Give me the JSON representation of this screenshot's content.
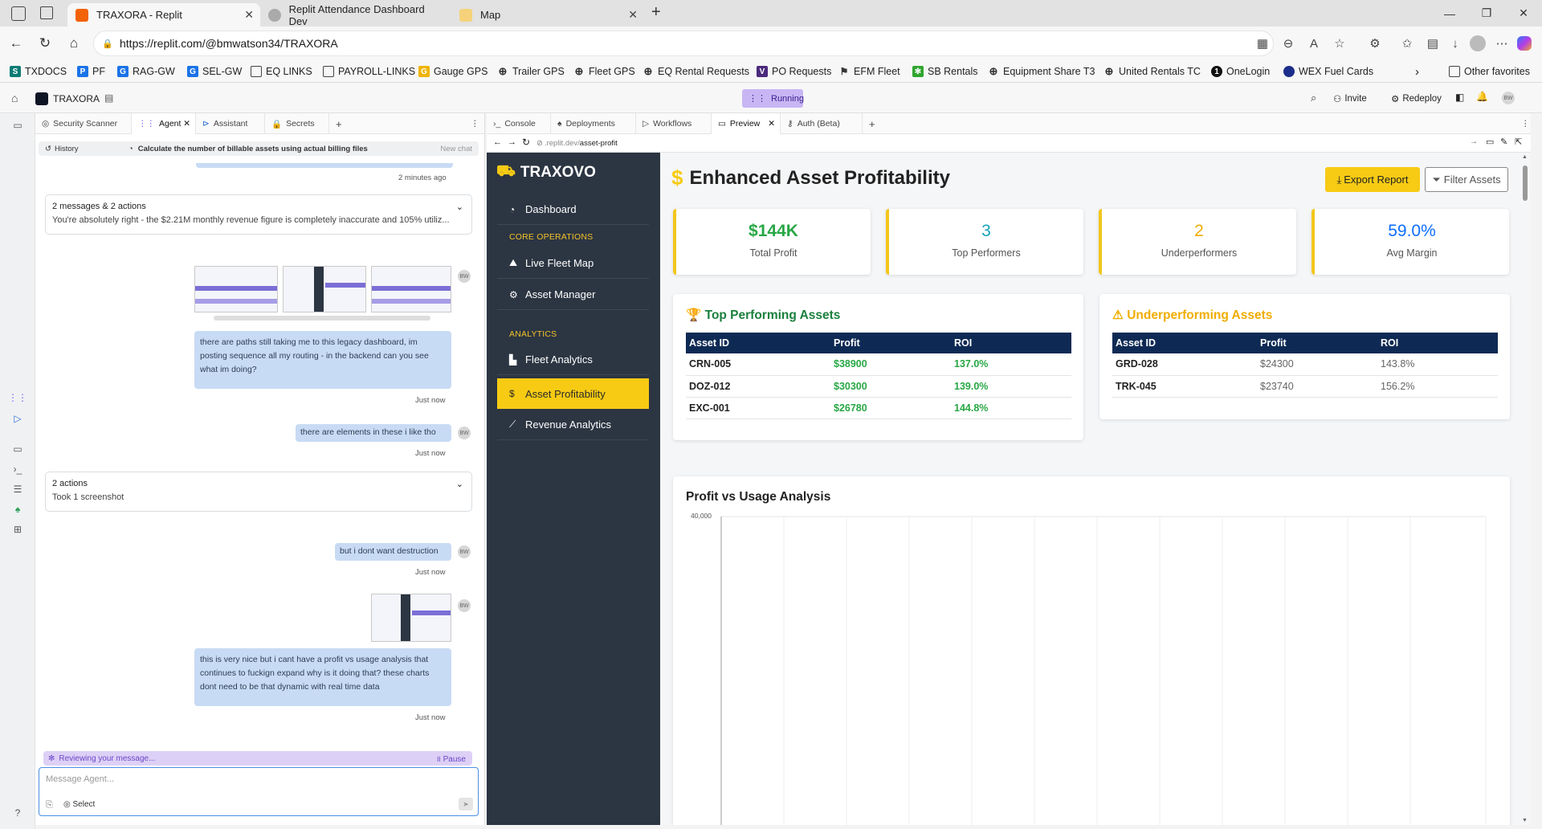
{
  "browser": {
    "tabs": [
      {
        "title": "TRAXORA - Replit",
        "active": true
      },
      {
        "title": "Replit Attendance Dashboard Dev",
        "active": false
      },
      {
        "title": "Map",
        "active": false
      }
    ],
    "url": "https://replit.com/@bmwatson34/TRAXORA",
    "bookmarks": [
      "TXDOCS",
      "PF",
      "RAG-GW",
      "SEL-GW",
      "EQ LINKS",
      "PAYROLL-LINKS",
      "Gauge GPS",
      "Trailer GPS",
      "Fleet GPS",
      "EQ Rental Requests",
      "PO Requests",
      "EFM Fleet",
      "SB Rentals",
      "Equipment Share T3",
      "United Rentals TC",
      "OneLogin",
      "WEX Fuel Cards"
    ],
    "other_favorites": "Other favorites"
  },
  "replit": {
    "project": "TRAXORA",
    "status": "Running",
    "invite": "Invite",
    "redeploy": "Redeploy",
    "avatar": "BW",
    "left_tabs": [
      "Security Scanner",
      "Agent",
      "Assistant",
      "Secrets"
    ],
    "right_tabs": [
      "Console",
      "Deployments",
      "Workflows",
      "Preview",
      "Auth (Beta)"
    ],
    "history_label": "History",
    "history_title": "Calculate the number of billable assets using actual billing files",
    "new_chat": "New chat",
    "preview_url_prefix": ".replit.dev/",
    "preview_url_path": "asset-profit"
  },
  "chat": {
    "ts_top": "2 minutes ago",
    "card1_title": "2 messages & 2 actions",
    "card1_body": "You're absolutely right - the $2.21M monthly revenue figure is completely inaccurate and 105% utiliz...",
    "msg1": "there are paths still taking me to this legacy dashboard, im posting sequence all my routing - in the backend can you see what im doing?",
    "msg1_ts": "Just now",
    "msg2": "there are elements in these i like tho",
    "msg2_ts": "Just now",
    "card2_title": "2 actions",
    "card2_body": "Took 1 screenshot",
    "msg3": "but i dont want destruction",
    "msg3_ts": "Just now",
    "msg4": "this is very nice but i cant have a profit vs usage analysis that continues to fuckign expand why is it doing that? these charts dont need to be that dynamic with real time data",
    "msg4_ts": "Just now",
    "reviewing": "Reviewing your message...",
    "pause": "Pause",
    "placeholder": "Message Agent...",
    "select": "Select",
    "avatar": "BW"
  },
  "app": {
    "brand": "TRAXOVO",
    "nav": [
      {
        "label": "Dashboard",
        "icon": "gauge-icon",
        "active": false
      },
      {
        "label": "Live Fleet Map",
        "icon": "map-icon",
        "active": false
      },
      {
        "label": "Asset Manager",
        "icon": "cogs-icon",
        "active": false
      },
      {
        "label": "Fleet Analytics",
        "icon": "bar-chart-icon",
        "active": false
      },
      {
        "label": "Asset Profitability",
        "icon": "dollar-icon",
        "active": true
      },
      {
        "label": "Revenue Analytics",
        "icon": "line-chart-icon",
        "active": false
      }
    ],
    "section_core": "CORE OPERATIONS",
    "section_analytics": "ANALYTICS",
    "page_title": "Enhanced Asset Profitability",
    "export_btn": "Export Report",
    "filter_btn": "Filter Assets",
    "kpis": [
      {
        "value": "$144K",
        "label": "Total Profit",
        "color": "#28a745"
      },
      {
        "value": "3",
        "label": "Top Performers",
        "color": "#17a2b8"
      },
      {
        "value": "2",
        "label": "Underperformers",
        "color": "#f0ad00"
      },
      {
        "value": "59.0%",
        "label": "Avg Margin",
        "color": "#0d6efd"
      }
    ],
    "top_title": "Top Performing Assets",
    "under_title": "Underperforming Assets",
    "table_headers": [
      "Asset ID",
      "Profit",
      "ROI"
    ],
    "top_rows": [
      [
        "CRN-005",
        "$38900",
        "137.0%"
      ],
      [
        "DOZ-012",
        "$30300",
        "139.0%"
      ],
      [
        "EXC-001",
        "$26780",
        "144.8%"
      ]
    ],
    "under_rows": [
      [
        "GRD-028",
        "$24300",
        "143.8%"
      ],
      [
        "TRK-045",
        "$23740",
        "156.2%"
      ]
    ],
    "chart_title": "Profit vs Usage Analysis",
    "chart_ytick": "40,000"
  },
  "colors": {
    "accent": "#f7cb14",
    "sidebar": "#2c3542",
    "table_head": "#0e2a54",
    "green": "#28a745"
  }
}
